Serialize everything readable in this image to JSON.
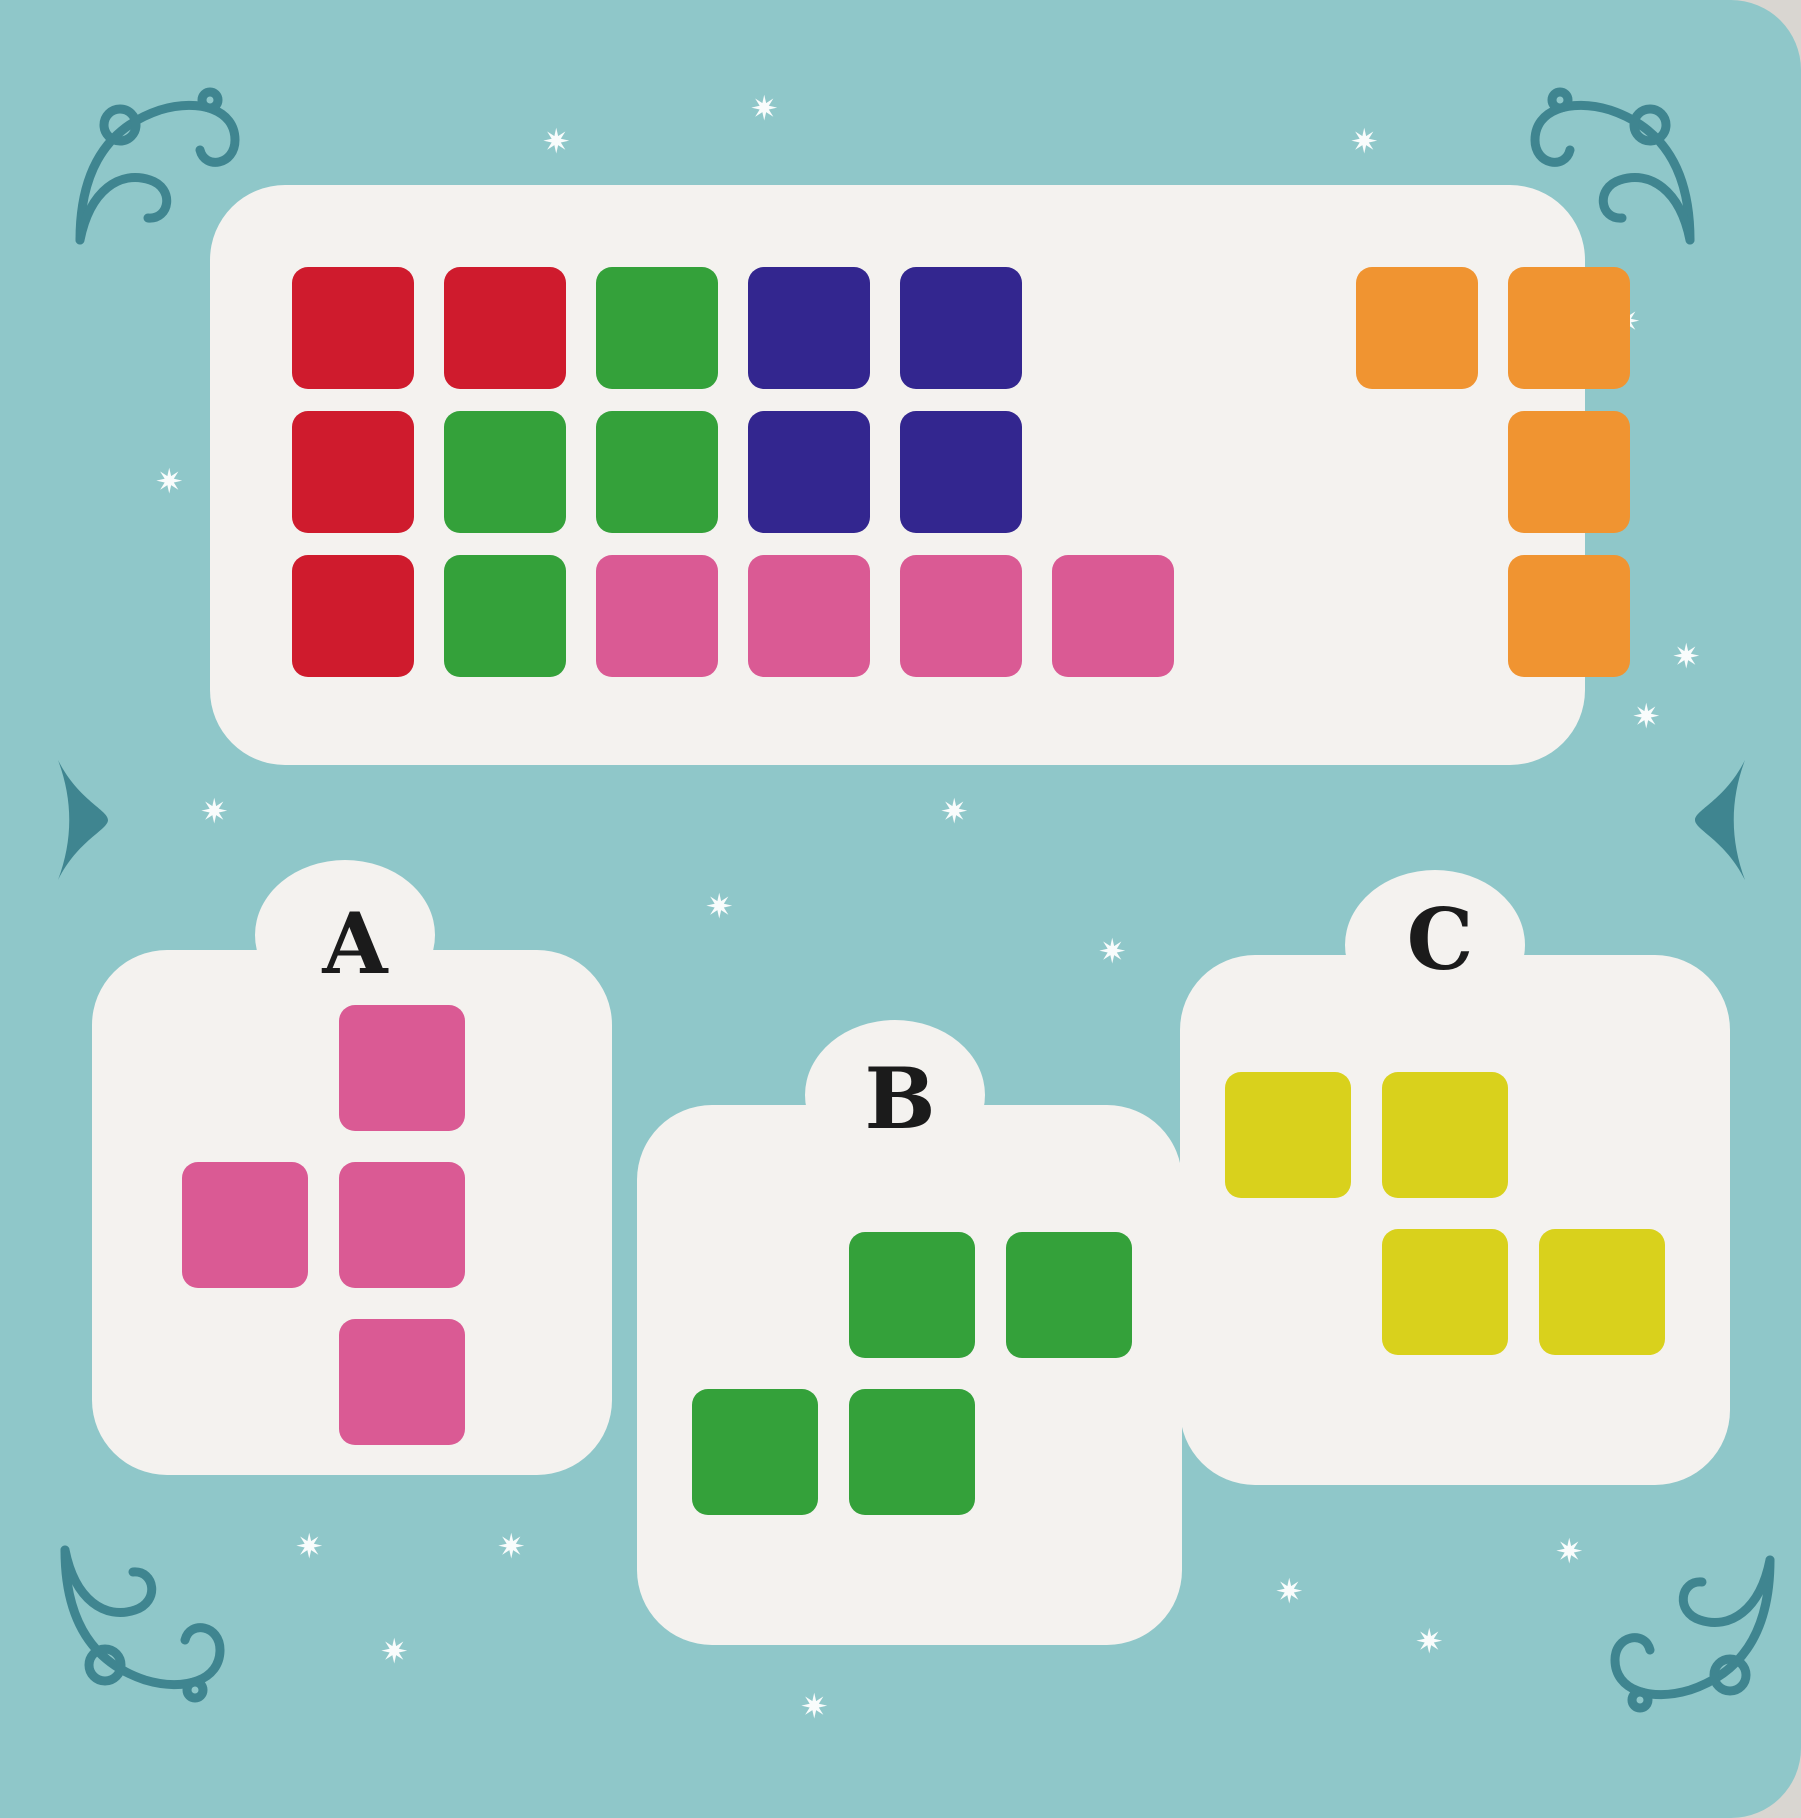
{
  "colors": {
    "background": "#8fc7c9",
    "panel": "#f4f2ef",
    "red": "#cf1b2d",
    "green": "#34a13a",
    "blue": "#33268f",
    "pink": "#da5a94",
    "orange": "#f09431",
    "yellow": "#d9d11c",
    "ornament": "#3f8590"
  },
  "puzzle": {
    "tile_rows": [
      [
        "red",
        "red",
        "green",
        "blue",
        "blue",
        "",
        "",
        "orange",
        "orange"
      ],
      [
        "red",
        "green",
        "green",
        "blue",
        "blue",
        "",
        "",
        "",
        "orange"
      ],
      [
        "red",
        "green",
        "pink",
        "pink",
        "pink",
        "pink",
        "",
        "",
        "orange"
      ]
    ]
  },
  "options": [
    {
      "label": "A",
      "color": "pink",
      "cells": [
        [
          1,
          0
        ],
        [
          0,
          1
        ],
        [
          1,
          1
        ],
        [
          1,
          2
        ]
      ]
    },
    {
      "label": "B",
      "color": "green",
      "cells": [
        [
          1,
          0
        ],
        [
          2,
          0
        ],
        [
          0,
          1
        ],
        [
          1,
          1
        ]
      ]
    },
    {
      "label": "C",
      "color": "yellow",
      "cells": [
        [
          0,
          0
        ],
        [
          1,
          0
        ],
        [
          1,
          1
        ],
        [
          2,
          1
        ]
      ]
    }
  ],
  "icons": [
    "swirl-corner-icon",
    "side-arrow-icon",
    "sparkle-star-icon"
  ]
}
